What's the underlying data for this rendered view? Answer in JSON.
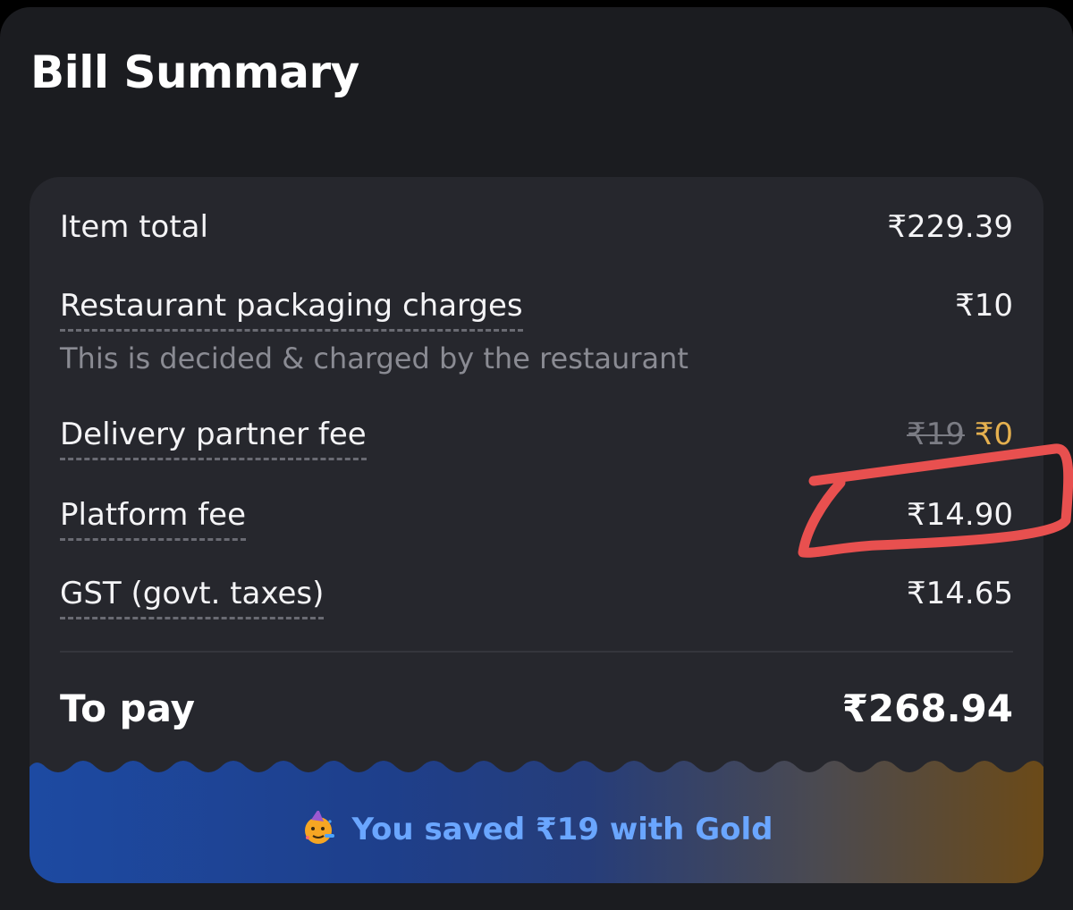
{
  "sheet": {
    "title": "Bill Summary"
  },
  "bill": {
    "rows": [
      {
        "label": "Item total",
        "value": "₹229.39"
      },
      {
        "label": "Restaurant packaging charges",
        "value": "₹10",
        "note": "This is decided & charged by the restaurant"
      },
      {
        "label": "Delivery partner fee",
        "original_value": "₹19",
        "value": "₹0"
      },
      {
        "label": "Platform fee",
        "value": "₹14.90"
      },
      {
        "label": "GST (govt. taxes)",
        "value": "₹14.65"
      }
    ],
    "total": {
      "label": "To pay",
      "value": "₹268.94"
    }
  },
  "savings_banner": {
    "icon": "party-face-icon",
    "text": "You saved ₹19 with Gold"
  },
  "colors": {
    "background": "#1b1c20",
    "card": "#26272d",
    "gold": "#e5b04f",
    "banner_text": "#6aa6ff",
    "annotation": "#e8504f"
  }
}
